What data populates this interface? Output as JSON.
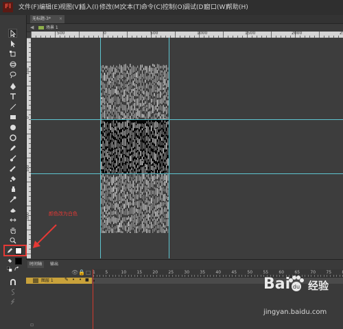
{
  "app": {
    "logo_text": "Fl"
  },
  "menubar": {
    "items": [
      "文件(F)",
      "编辑(E)",
      "视图(V)",
      "插入(I)",
      "修改(M)",
      "文本(T)",
      "命令(C)",
      "控制(O)",
      "调试(D)",
      "窗口(W)",
      "帮助(H)"
    ]
  },
  "document": {
    "tab_label": "无标题-3*",
    "tab_close": "×",
    "scene_label": "场景 1"
  },
  "ruler": {
    "horizontal_labels": [
      "500",
      "0",
      "500",
      "1000",
      "1500",
      "2000",
      "25"
    ],
    "vertical_labels": [
      "500",
      "0",
      "500",
      "1000"
    ]
  },
  "annotation": {
    "text": "颜色改为白色",
    "color": "#e53935"
  },
  "colors": {
    "guide": "#5fc6d2",
    "stroke_swatch": "#ffffff",
    "fill_swatch": "#000000",
    "highlight": "#e53935",
    "layer_bar": "#c9a23b",
    "playhead": "#d43a2f"
  },
  "timeline": {
    "tab_timeline": "时间轴",
    "tab_output": "输出",
    "layer_name": "图层 1",
    "frame_numbers": [
      "1",
      "5",
      "10",
      "15",
      "20",
      "25",
      "30",
      "35",
      "40",
      "45",
      "50",
      "55",
      "60",
      "65",
      "70",
      "75",
      "80"
    ]
  },
  "watermark": {
    "brand": "Bai",
    "brand_cn": "经验",
    "url": "jingyan.baidu.com"
  }
}
